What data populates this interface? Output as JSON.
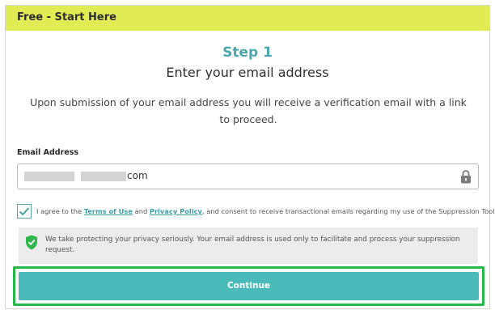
{
  "header": {
    "title": "Free - Start Here"
  },
  "step": {
    "title": "Step 1",
    "subtitle": "Enter your email address"
  },
  "description": "Upon submission of your email address you will receive a verification email with a link to proceed.",
  "email": {
    "label": "Email Address",
    "value_visible": "com",
    "icon": "lock-icon"
  },
  "agreement": {
    "checked": true,
    "prefix": "I agree to the ",
    "terms_link": "Terms of Use",
    "and": " and ",
    "privacy_link": "Privacy Policy",
    "suffix": ", and consent to receive transactional emails regarding my use of the Suppression Tool."
  },
  "privacy_notice": {
    "icon": "shield-check-icon",
    "text": "We take protecting your privacy seriously. Your email address is used only to facilitate and process your suppression request."
  },
  "continue_button": {
    "label": "Continue"
  },
  "colors": {
    "header_bg": "#e1ec55",
    "accent": "#4aa7b0",
    "button_bg": "#4bbaba",
    "highlight": "#27b84a",
    "shield": "#2fb64c"
  }
}
